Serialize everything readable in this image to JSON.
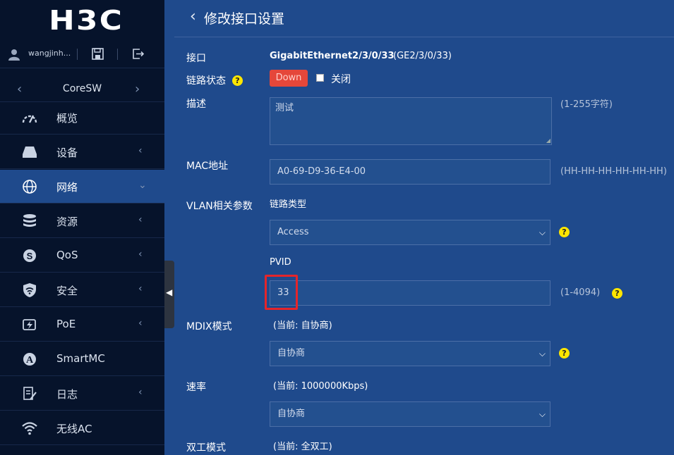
{
  "brand": {
    "logo": "H3C"
  },
  "user": {
    "name": "wangjinh..."
  },
  "device": {
    "name": "CoreSW",
    "prev": "‹",
    "next": "›"
  },
  "nav": [
    {
      "label": "概览",
      "icon": "dashboard-gauge-icon",
      "has_submenu": false,
      "active": false
    },
    {
      "label": "设备",
      "icon": "device-icon",
      "has_submenu": true,
      "active": false
    },
    {
      "label": "网络",
      "icon": "globe-icon",
      "has_submenu": true,
      "active": true
    },
    {
      "label": "资源",
      "icon": "database-icon",
      "has_submenu": true,
      "active": false
    },
    {
      "label": "QoS",
      "icon": "qos-icon",
      "has_submenu": true,
      "active": false
    },
    {
      "label": "安全",
      "icon": "shield-icon",
      "has_submenu": true,
      "active": false
    },
    {
      "label": "PoE",
      "icon": "poe-icon",
      "has_submenu": true,
      "active": false
    },
    {
      "label": "SmartMC",
      "icon": "smartmc-a-icon",
      "has_submenu": false,
      "active": false
    },
    {
      "label": "日志",
      "icon": "log-icon",
      "has_submenu": true,
      "active": false
    },
    {
      "label": "无线AC",
      "icon": "wifi-icon",
      "has_submenu": false,
      "active": false
    }
  ],
  "page": {
    "back": "‹",
    "title": "修改接口设置"
  },
  "form": {
    "interface": {
      "label": "接口",
      "value": "GigabitEthernet2/3/0/33",
      "short": "(GE2/3/0/33)"
    },
    "link_status": {
      "label": "链路状态",
      "badge": "Down",
      "checkbox_label": "关闭",
      "checked": false
    },
    "description": {
      "label": "描述",
      "value": "测试",
      "hint": "(1-255字符)"
    },
    "mac": {
      "label": "MAC地址",
      "value": "A0-69-D9-36-E4-00",
      "hint": "(HH-HH-HH-HH-HH-HH)"
    },
    "vlan": {
      "label": "VLAN相关参数",
      "link_type_label": "链路类型",
      "link_type_value": "Access",
      "pvid_label": "PVID",
      "pvid_value": "33",
      "pvid_hint": "(1-4094)"
    },
    "mdix": {
      "label": "MDIX模式",
      "current": "(当前:  自协商)",
      "value": "自协商"
    },
    "speed": {
      "label": "速率",
      "current": "(当前:  1000000Kbps)",
      "value": "自协商"
    },
    "duplex": {
      "label": "双工模式",
      "current": "(当前:  全双工)"
    }
  },
  "help_glyph": "?",
  "colors": {
    "sidebar_bg": "#06132b",
    "content_bg": "#1f4a8c",
    "field_bg": "#23508f",
    "down_badge": "#e5473a",
    "highlight": "#e5252a",
    "help": "#ffe600"
  }
}
